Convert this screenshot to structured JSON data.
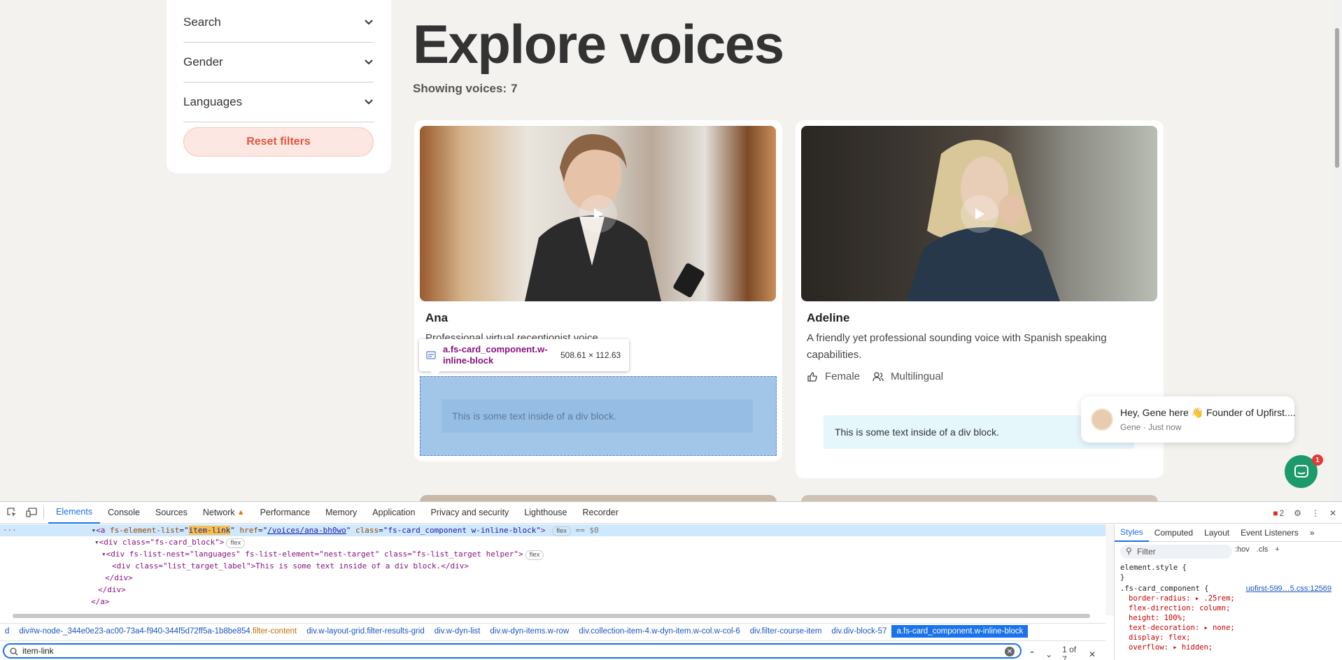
{
  "filters": {
    "items": [
      "Search",
      "Gender",
      "Languages"
    ],
    "reset_label": "Reset filters"
  },
  "main": {
    "title": "Explore voices",
    "showing_label": "Showing voices:",
    "showing_count": "7"
  },
  "cards": [
    {
      "name": "Ana",
      "description": "Professional virtual receptionist voice",
      "inner_text": "This is some text inside of a div block."
    },
    {
      "name": "Adeline",
      "description": "A friendly yet professional sounding voice with Spanish speaking capabilities.",
      "gender": "Female",
      "language": "Multilingual",
      "inner_text": "This is some text inside of a div block."
    }
  ],
  "inspect_tooltip": {
    "selector": "a.fs-card_component.w-inline-block",
    "size": "508.61 × 112.63"
  },
  "chat": {
    "message": "Hey, Gene here 👋 Founder of Upfirst....",
    "sub": "Gene · Just now",
    "badge": "1"
  },
  "devtools": {
    "tabs": [
      "Elements",
      "Console",
      "Sources",
      "Network",
      "Performance",
      "Memory",
      "Application",
      "Privacy and security",
      "Lighthouse",
      "Recorder"
    ],
    "active_tab": "Elements",
    "error_count": "2",
    "code_lines": {
      "l1_tag_open": "<a",
      "l1_attr1": "fs-element-list",
      "l1_val1": "item-link",
      "l1_attr2": "href",
      "l1_val2": "/voices/ana-bh0wo",
      "l1_attr3": "class",
      "l1_val3": "fs-card_component w-inline-block",
      "l1_badge": "flex",
      "l1_dollar": "== $0",
      "l2": "<div class=\"fs-card_block\">",
      "l2_badge": "flex",
      "l3": "<div fs-list-nest=\"languages\" fs-list-element=\"nest-target\" class=\"fs-list_target helper\">",
      "l3_badge": "flex",
      "l4": "<div class=\"list_target_label\">This is some text inside of a div block.</div>",
      "l5": "</div>",
      "l6": "</div>",
      "l7": "</a>"
    },
    "breadcrumbs": [
      {
        "text": "d",
        "cls": ""
      },
      {
        "text": "div#w-node-_344e0e23-ac00-73a4-f940-344f5d72ff5a-1b8be854",
        "cls": ".filter-content"
      },
      {
        "text": "div.w-layout-grid.filter-results-grid",
        "cls": ""
      },
      {
        "text": "div.w-dyn-list",
        "cls": ""
      },
      {
        "text": "div.w-dyn-items.w-row",
        "cls": ""
      },
      {
        "text": "div.collection-item-4.w-dyn-item.w-col.w-col-6",
        "cls": ""
      },
      {
        "text": "div.filter-course-item",
        "cls": ""
      },
      {
        "text": "div.div-block-57",
        "cls": ""
      },
      {
        "text": "a.fs-card_component.w-inline-block",
        "cls": ""
      }
    ],
    "search_value": "item-link",
    "search_result": "1 of 7",
    "styles": {
      "tabs": [
        "Styles",
        "Computed",
        "Layout",
        "Event Listeners"
      ],
      "filter_placeholder": "Filter",
      "tools": [
        ":hov",
        ".cls",
        "+"
      ],
      "element_style": "element.style {",
      "close_brace": "}",
      "rule_selector": ".fs-card_component {",
      "rule_source": "upfirst-599…5.css:12569",
      "props": [
        "border-radius: ▸ .25rem;",
        "flex-direction: column;",
        "height: 100%;",
        "text-decoration: ▸ none;",
        "display: flex;",
        "overflow: ▸ hidden;"
      ]
    }
  }
}
